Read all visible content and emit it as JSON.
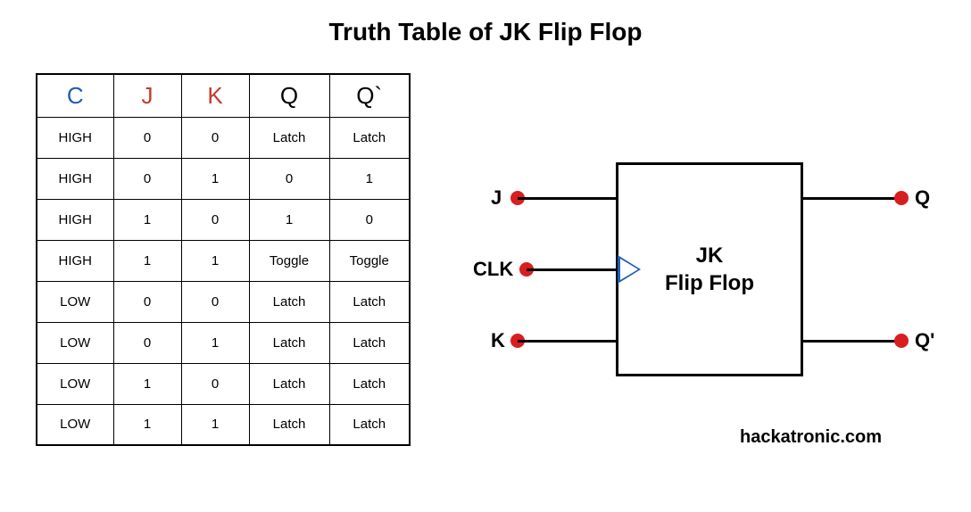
{
  "title": "Truth Table of JK Flip Flop",
  "table": {
    "headers": {
      "c": "C",
      "j": "J",
      "k": "K",
      "q": "Q",
      "qp": "Q`"
    },
    "rows": [
      {
        "c": "HIGH",
        "j": "0",
        "k": "0",
        "q": "Latch",
        "qp": "Latch"
      },
      {
        "c": "HIGH",
        "j": "0",
        "k": "1",
        "q": "0",
        "qp": "1"
      },
      {
        "c": "HIGH",
        "j": "1",
        "k": "0",
        "q": "1",
        "qp": "0"
      },
      {
        "c": "HIGH",
        "j": "1",
        "k": "1",
        "q": "Toggle",
        "qp": "Toggle"
      },
      {
        "c": "LOW",
        "j": "0",
        "k": "0",
        "q": "Latch",
        "qp": "Latch"
      },
      {
        "c": "LOW",
        "j": "0",
        "k": "1",
        "q": "Latch",
        "qp": "Latch"
      },
      {
        "c": "LOW",
        "j": "1",
        "k": "0",
        "q": "Latch",
        "qp": "Latch"
      },
      {
        "c": "LOW",
        "j": "1",
        "k": "1",
        "q": "Latch",
        "qp": "Latch"
      }
    ]
  },
  "diagram": {
    "box_line1": "JK",
    "box_line2": "Flip Flop",
    "pins": {
      "j": "J",
      "clk": "CLK",
      "k": "K",
      "q": "Q",
      "qp": "Q'"
    }
  },
  "credit": "hackatronic.com"
}
